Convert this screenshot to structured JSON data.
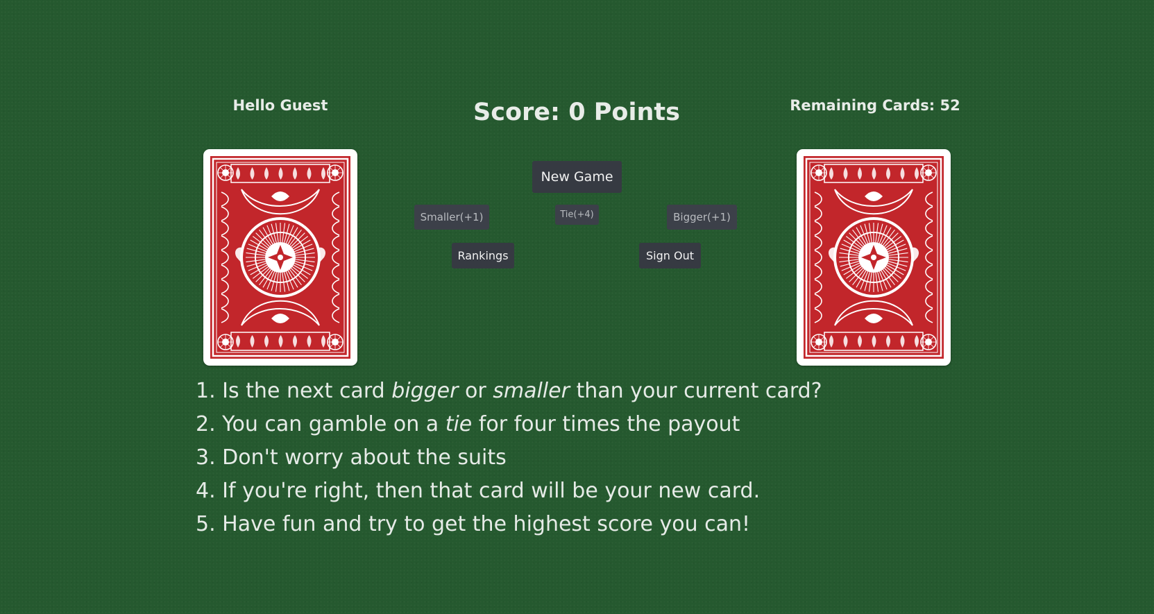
{
  "header": {
    "greeting": "Hello Guest",
    "score": "Score: 0 Points",
    "remaining_cards": "Remaining Cards: 52"
  },
  "cards": {
    "left": {
      "state": "face-down",
      "back_color": "#c2262b"
    },
    "right": {
      "state": "face-down",
      "back_color": "#c2262b"
    }
  },
  "controls": {
    "new_game": "New Game",
    "smaller": "Smaller(+1)",
    "tie": "Tie(+4)",
    "bigger": "Bigger(+1)",
    "rankings": "Rankings",
    "sign_out": "Sign Out"
  },
  "rules": [
    {
      "prefix": "1. Is the next card ",
      "em1": "bigger",
      "mid": " or ",
      "em2": "smaller",
      "suffix": " than your current card?"
    },
    {
      "prefix": "2. You can gamble on a ",
      "em1": "tie",
      "suffix": " for four times the payout"
    },
    {
      "text": "3. Don't worry about the suits"
    },
    {
      "text": "4. If you're right, then that card will be your new card."
    },
    {
      "text": "5. Have fun and try to get the highest score you can!"
    }
  ],
  "colors": {
    "table_felt": "#25592f",
    "button_bg": "#363a42",
    "card_back_red": "#c2262b"
  }
}
